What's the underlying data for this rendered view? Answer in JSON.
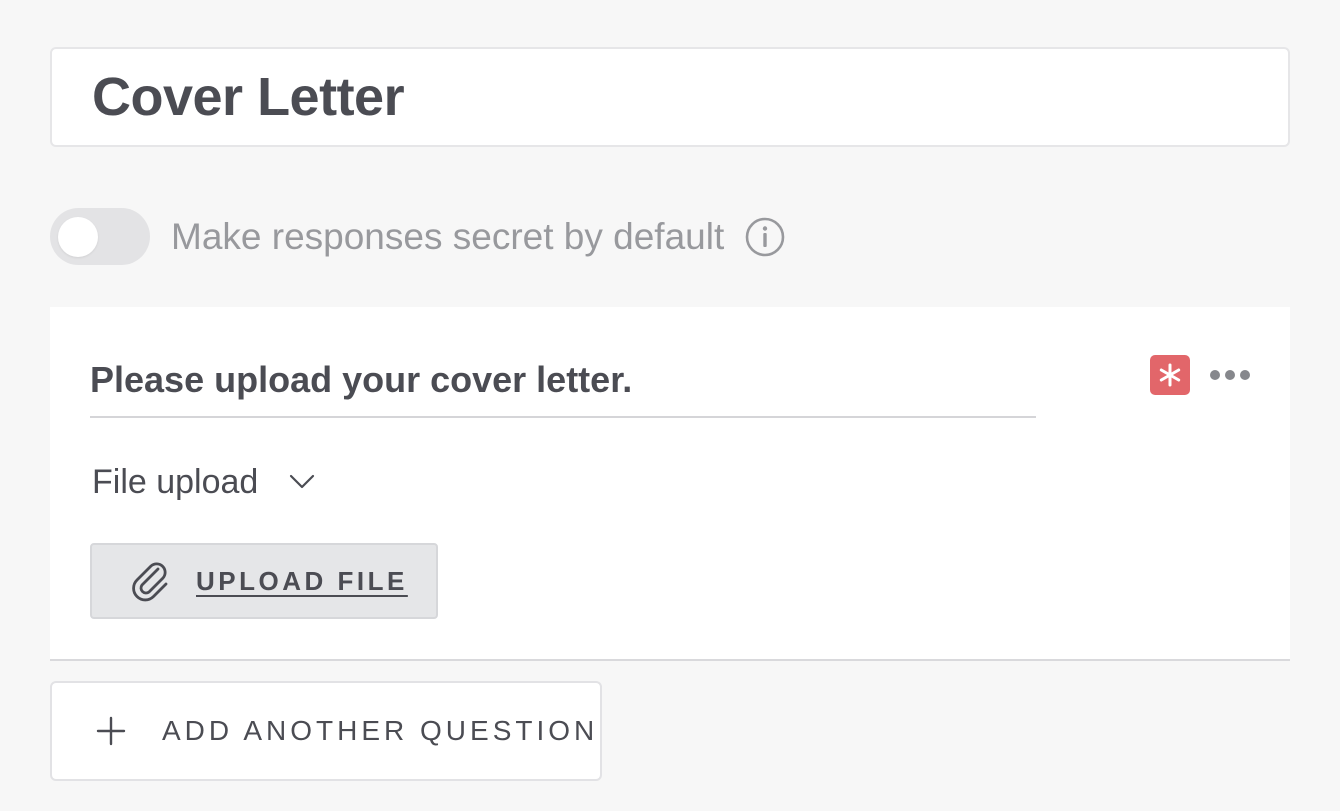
{
  "form": {
    "title": "Cover Letter"
  },
  "secret_toggle": {
    "label": "Make responses secret by default",
    "on": false
  },
  "question": {
    "text": "Please upload your cover letter.",
    "type_selected": "File upload",
    "required": true,
    "upload_label": "UPLOAD FILE"
  },
  "add_question": {
    "label": "ADD ANOTHER QUESTION"
  },
  "colors": {
    "required_badge": "#e2666a",
    "text": "#4b4c53",
    "muted_text": "#98999d",
    "page_bg": "#f7f7f7"
  },
  "icons": [
    "info-icon",
    "asterisk-icon",
    "more-options-icon",
    "chevron-down-icon",
    "paperclip-icon",
    "plus-icon"
  ]
}
